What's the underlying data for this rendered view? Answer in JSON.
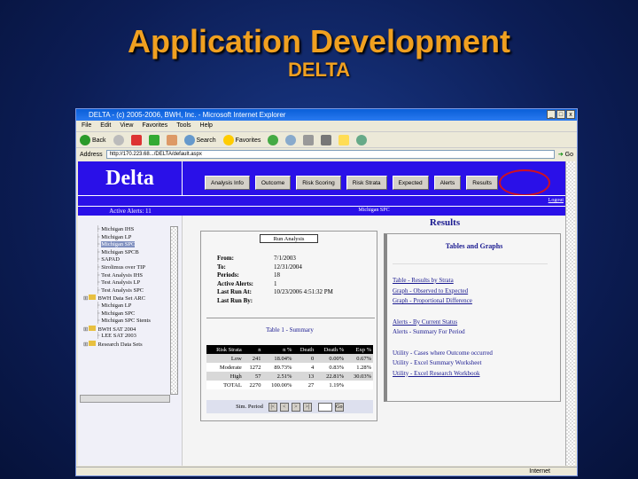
{
  "slide": {
    "title": "Application Development",
    "subtitle": "DELTA"
  },
  "browser": {
    "title": "DELTA - (c) 2005-2006, BWH, Inc. - Microsoft Internet Explorer",
    "menu": [
      "File",
      "Edit",
      "View",
      "Favorites",
      "Tools",
      "Help"
    ],
    "toolbar": {
      "back": "Back",
      "search": "Search",
      "favorites": "Favorites"
    },
    "address_label": "Address",
    "address": "http://170.223.68.../DELTA/default.aspx",
    "go": "Go",
    "status": "Internet"
  },
  "app": {
    "logo": "Delta",
    "nav": [
      "Analysis Info",
      "Outcome",
      "Risk Scoring",
      "Risk Strata",
      "Expected",
      "Alerts",
      "Results"
    ],
    "logout": "Logout",
    "active_alerts": "Active Alerts: 11",
    "analysis_name": "Michigan SPC",
    "page_title": "Results",
    "tree": [
      {
        "label": "Michigan IHS",
        "indent": 1
      },
      {
        "label": "Michigan LP",
        "indent": 1
      },
      {
        "label": "Michigan SPC",
        "indent": 1,
        "selected": true
      },
      {
        "label": "Michigan SPCB",
        "indent": 1
      },
      {
        "label": "SAPAD",
        "indent": 1
      },
      {
        "label": "Sirolimus over TIP",
        "indent": 1
      },
      {
        "label": "Test Analysis IHS",
        "indent": 1
      },
      {
        "label": "Test Analysis LP",
        "indent": 1
      },
      {
        "label": "Test Analysis SPC",
        "indent": 1
      },
      {
        "label": "BWH Data Set ARC",
        "indent": 0,
        "folder": true
      },
      {
        "label": "Michigan LP",
        "indent": 1
      },
      {
        "label": "Michigan SPC",
        "indent": 1
      },
      {
        "label": "Michigan SPC Stents",
        "indent": 1
      },
      {
        "label": "BWH SAT 2004",
        "indent": 0,
        "folder": true
      },
      {
        "label": "LEE SAT 2003",
        "indent": 1
      },
      {
        "label": "Research Data Sets",
        "indent": 0,
        "folder": true
      }
    ],
    "run_button": "Run Analysis",
    "info": [
      [
        "From:",
        "7/1/2003"
      ],
      [
        "To:",
        "12/31/2004"
      ],
      [
        "Periods:",
        "18"
      ],
      [
        "Active Alerts:",
        "1"
      ],
      [
        "Last Run At:",
        "10/23/2006 4:51:32 PM"
      ],
      [
        "Last Run By:",
        ""
      ]
    ],
    "table_title": "Table 1 - Summary",
    "table": {
      "headers": [
        "Risk Strata",
        "n",
        "n %",
        "Death",
        "Death %",
        "Exp %"
      ],
      "rows": [
        [
          "Low",
          "241",
          "18.04%",
          "0",
          "0.00%",
          "0.67%"
        ],
        [
          "Moderate",
          "1272",
          "89.73%",
          "4",
          "0.83%",
          "1.28%"
        ],
        [
          "High",
          "57",
          "2.51%",
          "13",
          "22.81%",
          "30.03%"
        ],
        [
          "TOTAL",
          "2270",
          "100.00%",
          "27",
          "1.19%",
          ""
        ]
      ]
    },
    "sim_period_label": "Sim. Period",
    "pager": [
      "|<",
      "<",
      ">",
      ">|"
    ],
    "pager_go": "Go",
    "tg_title": "Tables and Graphs",
    "links": [
      "Table - Results by Strata",
      "Graph - Observed to Expected",
      "Graph - Proportional Difference"
    ],
    "alert_links": [
      "Alerts - By Current Status",
      "Alerts - Summary For Period"
    ],
    "util_links": [
      "Utility - Cases where Outcome occurred",
      "Utility - Excel Summary Worksheet",
      "Utility - Excel Research Workbook"
    ]
  }
}
